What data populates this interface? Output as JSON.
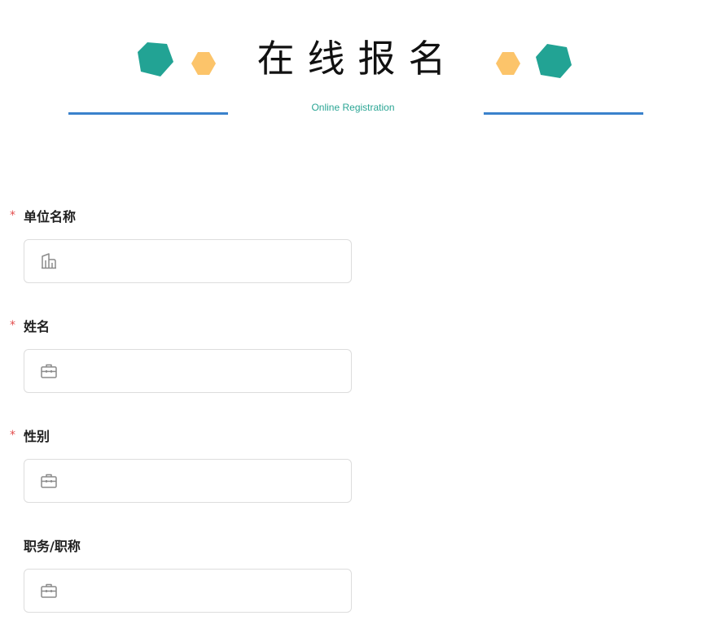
{
  "banner": {
    "title": "在线报名",
    "subtitle": "Online Registration",
    "colors": {
      "teal": "#22a394",
      "yellow": "#fcc46a",
      "line": "#3a82cc"
    }
  },
  "form": {
    "fields": [
      {
        "label": "单位名称",
        "required": true,
        "icon": "building-icon",
        "value": "",
        "placeholder": ""
      },
      {
        "label": "姓名",
        "required": true,
        "icon": "briefcase-icon",
        "value": "",
        "placeholder": ""
      },
      {
        "label": "性别",
        "required": true,
        "icon": "briefcase-icon",
        "value": "",
        "placeholder": ""
      },
      {
        "label": "职务/职称",
        "required": false,
        "icon": "briefcase-icon",
        "value": "",
        "placeholder": ""
      }
    ],
    "required_mark": "*"
  }
}
